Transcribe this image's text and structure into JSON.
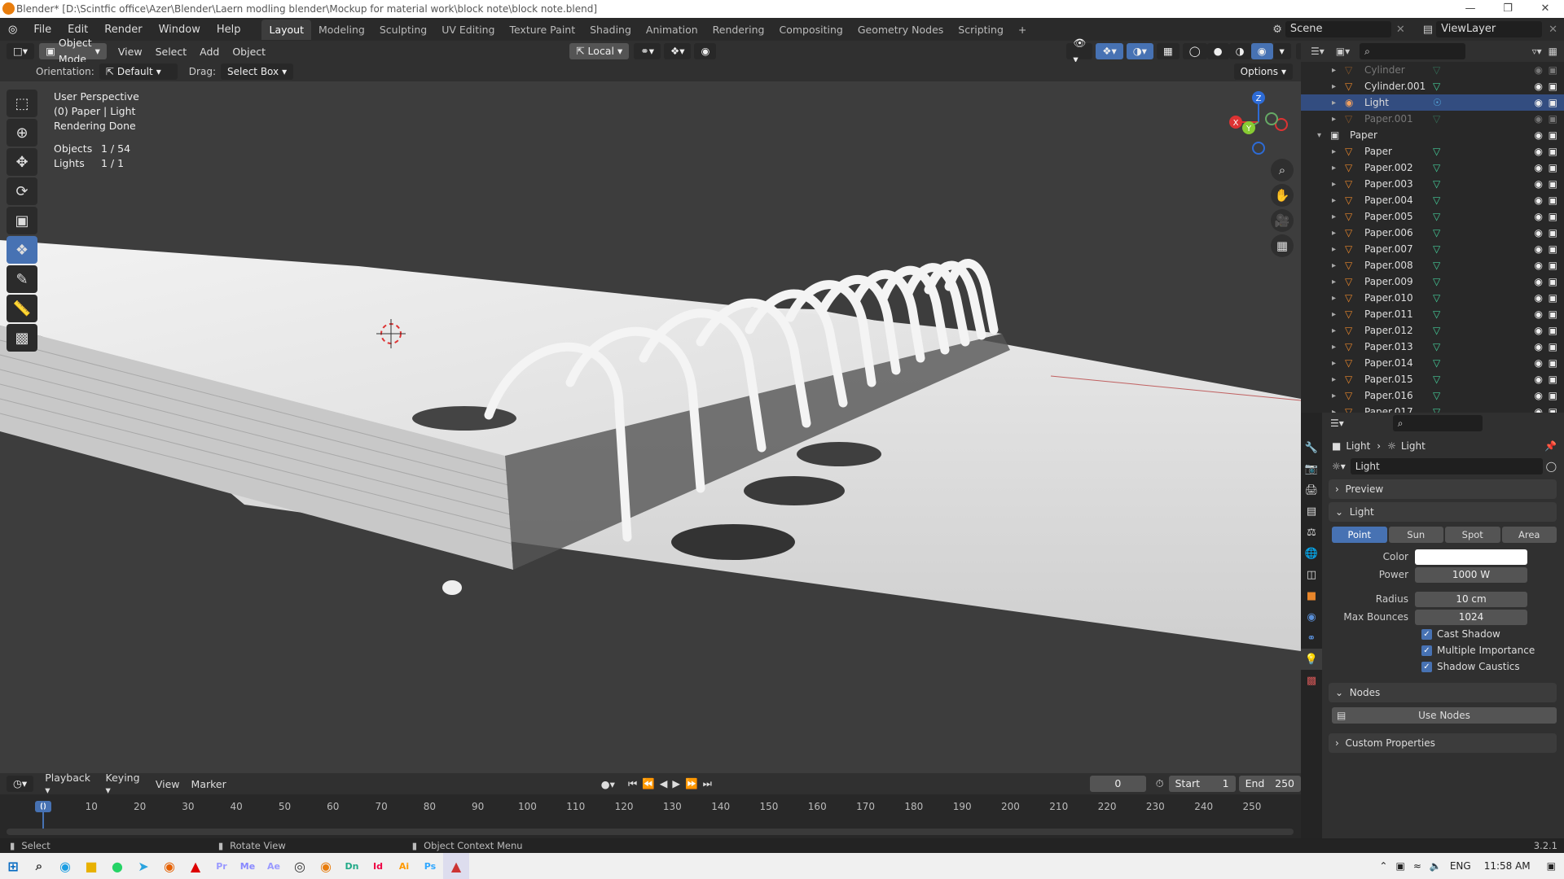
{
  "window": {
    "title": "Blender* [D:\\Scintfic office\\Azer\\Blender\\Laern modling blender\\Mockup for material work\\block note\\block note.blend]"
  },
  "menu": [
    "File",
    "Edit",
    "Render",
    "Window",
    "Help"
  ],
  "workspaces": [
    "Layout",
    "Modeling",
    "Sculpting",
    "UV Editing",
    "Texture Paint",
    "Shading",
    "Animation",
    "Rendering",
    "Compositing",
    "Geometry Nodes",
    "Scripting"
  ],
  "scene": {
    "name": "Scene",
    "view_layer": "ViewLayer"
  },
  "viewport_header": {
    "mode": "Object Mode",
    "items": [
      "View",
      "Select",
      "Add",
      "Object"
    ],
    "transform": "Local",
    "options": "Options",
    "orientation_label": "Orientation:",
    "orientation_value": "Default",
    "drag_label": "Drag:",
    "drag_value": "Select Box"
  },
  "viewport_info": {
    "perspective": "User Perspective",
    "collection": "(0) Paper | Light",
    "status": "Rendering Done",
    "objects_label": "Objects",
    "objects_value": "1 / 54",
    "lights_label": "Lights",
    "lights_value": "1 / 1"
  },
  "gizmo": {
    "x": "X",
    "y": "Y",
    "z": "Z"
  },
  "outliner": {
    "rows": [
      {
        "name": "Cylinder",
        "dim": true
      },
      {
        "name": "Cylinder.001",
        "dim": false
      },
      {
        "name": "Light",
        "dim": false,
        "selected": true
      },
      {
        "name": "Paper.001",
        "dim": true
      },
      {
        "name": "Paper",
        "dim": false,
        "collection": true
      },
      {
        "name": "Paper",
        "dim": false
      },
      {
        "name": "Paper.002",
        "dim": false
      },
      {
        "name": "Paper.003",
        "dim": false
      },
      {
        "name": "Paper.004",
        "dim": false
      },
      {
        "name": "Paper.005",
        "dim": false
      },
      {
        "name": "Paper.006",
        "dim": false
      },
      {
        "name": "Paper.007",
        "dim": false
      },
      {
        "name": "Paper.008",
        "dim": false
      },
      {
        "name": "Paper.009",
        "dim": false
      },
      {
        "name": "Paper.010",
        "dim": false
      },
      {
        "name": "Paper.011",
        "dim": false
      },
      {
        "name": "Paper.012",
        "dim": false
      },
      {
        "name": "Paper.013",
        "dim": false
      },
      {
        "name": "Paper.014",
        "dim": false
      },
      {
        "name": "Paper.015",
        "dim": false
      },
      {
        "name": "Paper.016",
        "dim": false
      },
      {
        "name": "Paper.017",
        "dim": false
      }
    ]
  },
  "properties": {
    "breadcrumb_a": "Light",
    "breadcrumb_b": "Light",
    "datablock": "Light",
    "preview": "Preview",
    "light_panel": "Light",
    "light_types": [
      "Point",
      "Sun",
      "Spot",
      "Area"
    ],
    "color_label": "Color",
    "power_label": "Power",
    "power_value": "1000 W",
    "radius_label": "Radius",
    "radius_value": "10 cm",
    "bounces_label": "Max Bounces",
    "bounces_value": "1024",
    "cast_shadow": "Cast Shadow",
    "multiple_importance": "Multiple Importance",
    "shadow_caustics": "Shadow Caustics",
    "nodes_panel": "Nodes",
    "use_nodes": "Use Nodes",
    "custom_props": "Custom Properties"
  },
  "timeline": {
    "playback": "Playback",
    "keying": "Keying",
    "view": "View",
    "marker": "Marker",
    "current_frame": "0",
    "start_label": "Start",
    "start_value": "1",
    "end_label": "End",
    "end_value": "250",
    "ticks": [
      "0",
      "10",
      "20",
      "30",
      "40",
      "50",
      "60",
      "70",
      "80",
      "90",
      "100",
      "110",
      "120",
      "130",
      "140",
      "150",
      "160",
      "170",
      "180",
      "190",
      "200",
      "210",
      "220",
      "230",
      "240",
      "250"
    ]
  },
  "status": {
    "select": "Select",
    "rotate": "Rotate View",
    "context": "Object Context Menu",
    "version": "3.2.1"
  },
  "taskbar": {
    "lang": "ENG",
    "time": "11:58 AM",
    "apps": [
      "Pr",
      "Me",
      "Ae",
      "Dn",
      "Id",
      "Ai",
      "Ps"
    ]
  },
  "colors": {
    "accent": "#4772b3",
    "selected_row": "#334d80",
    "viewport_bg": "#3d3d3d"
  }
}
